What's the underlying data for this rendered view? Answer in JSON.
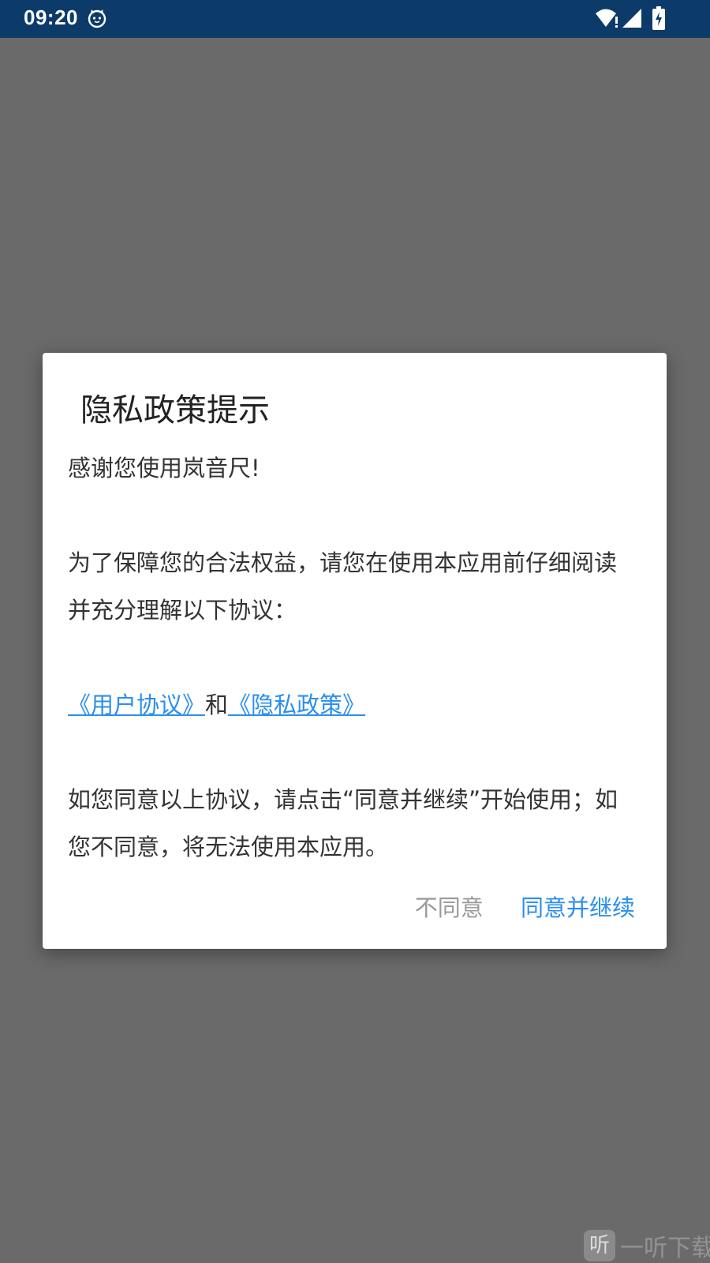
{
  "status_bar": {
    "time": "09:20",
    "icons": [
      "cat-icon",
      "wifi-icon",
      "signal-icon",
      "battery-charging-icon"
    ]
  },
  "dialog": {
    "title": "隐私政策提示",
    "greeting": "感谢您使用岚音尺!",
    "intro": "为了保障您的合法权益，请您在使用本应用前仔细阅读并充分理解以下协议：",
    "user_agreement_link": "《用户协议》",
    "and_text": "和",
    "privacy_policy_link": "《隐私政策》",
    "closing": "如您同意以上协议，请点击“同意并继续”开始使用；如您不同意，将无法使用本应用。",
    "disagree_button": "不同意",
    "agree_button": "同意并继续"
  },
  "watermark": {
    "icon_glyph": "听",
    "text": "一听下载"
  },
  "colors": {
    "status_bar": "#0c3b6a",
    "overlay": "#6a6a6a",
    "accent": "#2a8ff0",
    "muted": "#9a9a9a"
  }
}
